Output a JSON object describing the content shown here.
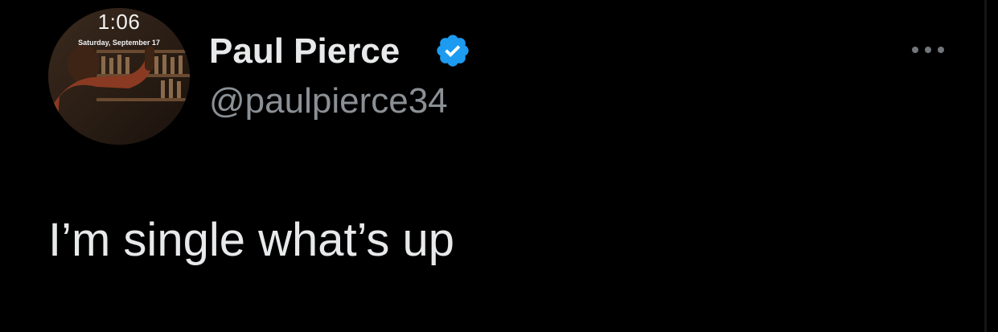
{
  "avatar": {
    "lock_time": "1:06",
    "lock_date": "Saturday, September 17"
  },
  "author": {
    "display_name": "Paul Pierce",
    "handle": "@paulpierce34",
    "verified_icon": "verified-badge-icon"
  },
  "menu": {
    "icon": "more-options-icon"
  },
  "tweet": {
    "text": "I’m single what’s up"
  },
  "colors": {
    "background": "#000000",
    "primary_text": "#e7e9ea",
    "secondary_text": "#8b9095",
    "verified_blue": "#1d9bf0"
  }
}
